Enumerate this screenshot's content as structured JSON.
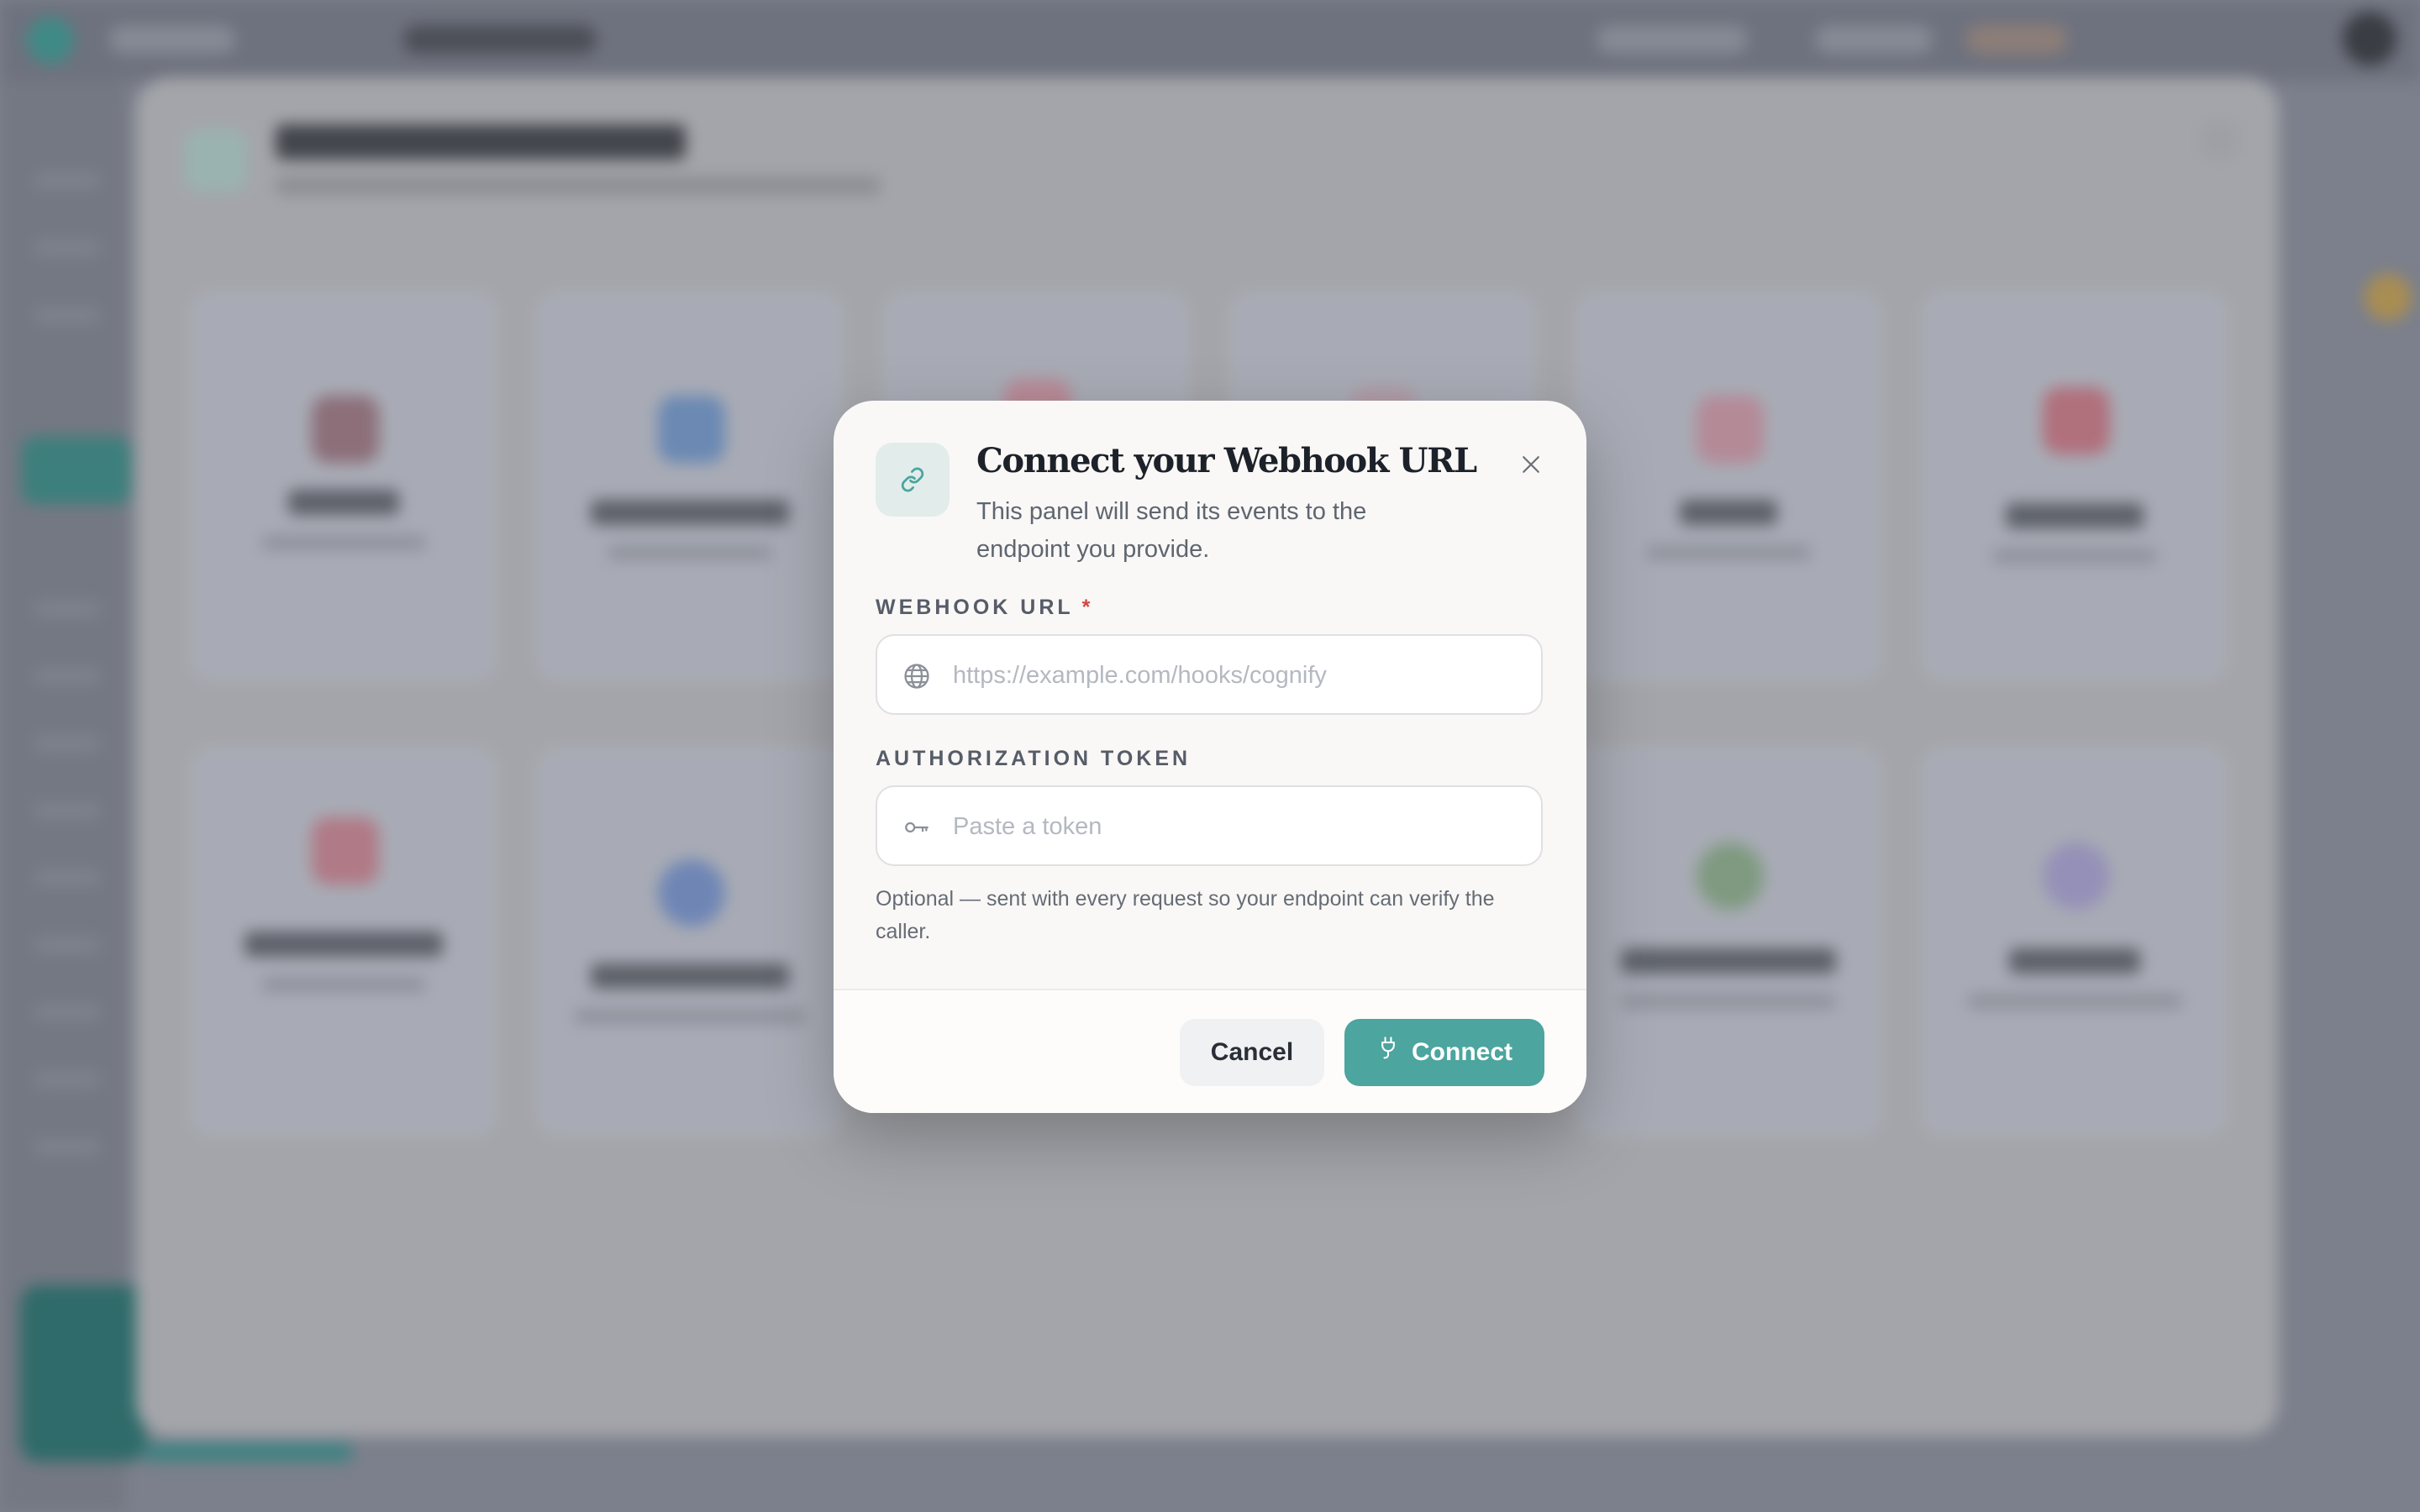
{
  "dialog": {
    "title": "Connect your Webhook URL",
    "description": "This panel will send its events to the endpoint you provide.",
    "icon": "link-icon",
    "close_icon": "close-icon"
  },
  "fields": {
    "webhook_url": {
      "label": "WEBHOOK URL",
      "required_marker": "*",
      "placeholder": "https://example.com/hooks/cognify",
      "value": "",
      "icon": "globe-icon"
    },
    "auth_token": {
      "label": "AUTHORIZATION TOKEN",
      "placeholder": "Paste a token",
      "value": "",
      "icon": "key-icon",
      "help": "Optional — sent with every request so your endpoint can verify the caller."
    }
  },
  "footer": {
    "cancel_label": "Cancel",
    "connect_label": "Connect",
    "connect_icon": "plug-icon"
  },
  "colors": {
    "accent": "#4ca59e",
    "required": "#d2463f",
    "overlay": "#7c808c"
  }
}
